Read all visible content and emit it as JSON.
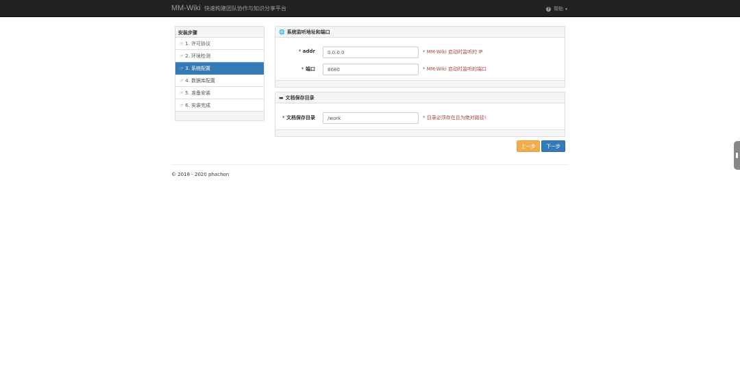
{
  "navbar": {
    "brand": "MM-Wiki",
    "subtitle": "快速构建团队协作与知识分享平台",
    "help_label": "帮助"
  },
  "sidebar": {
    "title": "安装步骤",
    "steps": [
      {
        "label": "1. 许可协议"
      },
      {
        "label": "2. 环境检测"
      },
      {
        "label": "3. 系统配置"
      },
      {
        "label": "4. 数据库配置"
      },
      {
        "label": "5. 准备安装"
      },
      {
        "label": "6. 安装完成"
      }
    ],
    "active_index": 2
  },
  "panel_listen": {
    "title": "系统监听地址和端口",
    "addr": {
      "label": "addr",
      "value": "0.0.0.0",
      "hint": "* MM-Wiki 启动时监听的 IP"
    },
    "port": {
      "label": "端口",
      "value": "8080",
      "hint": "* MM-Wiki 启动时监听的端口"
    }
  },
  "panel_docs": {
    "title": "文档保存目录",
    "dir": {
      "label": "文档保存目录",
      "value": "/work",
      "hint": "* 目录必须存在且为绝对路径!"
    }
  },
  "buttons": {
    "prev": "上一步",
    "next": "下一步"
  },
  "footer": {
    "copyright": "© 2018 - 2020 phachon"
  },
  "colors": {
    "navbar_bg": "#222222",
    "primary": "#337ab7",
    "warning": "#f0ad4e",
    "danger_text": "#a94442"
  }
}
